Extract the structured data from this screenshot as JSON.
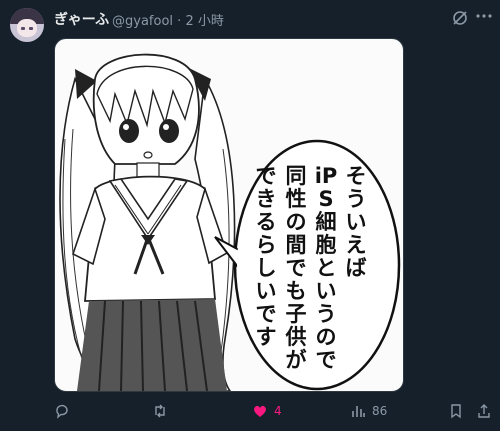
{
  "post": {
    "author_name": "ぎゃーふ",
    "handle": "@gyafool",
    "separator": "·",
    "time": "2 小時",
    "image_text_columns": [
      "そういえば",
      "iPS細胞というので",
      "同性の間でも子供が",
      "できるらしいです"
    ],
    "likes": "4",
    "views": "86"
  },
  "icons": {
    "grok": "grok-icon",
    "more": "more-icon",
    "reply": "reply-icon",
    "repost": "repost-icon",
    "like": "heart-icon",
    "views": "views-icon",
    "bookmark": "bookmark-icon",
    "share": "share-icon"
  },
  "colors": {
    "background": "#15202b",
    "muted": "#8b98a5",
    "like": "#f91880"
  }
}
